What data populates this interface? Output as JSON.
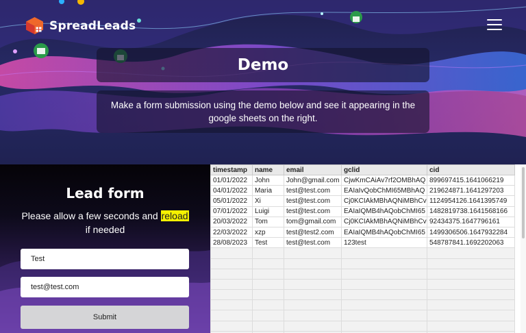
{
  "brand": {
    "name": "SpreadLeads"
  },
  "hero": {
    "title": "Demo",
    "description": "Make a form submission using the demo below and see it appearing in the google sheets on the right."
  },
  "form": {
    "title": "Lead form",
    "note_before": "Please allow a few seconds and ",
    "note_highlight": "reload",
    "note_after": " if needed",
    "name_value": "Test",
    "email_value": "test@test.com",
    "submit_label": "Submit"
  },
  "sheet": {
    "columns": [
      "timestamp",
      "name",
      "email",
      "gclid",
      "cid"
    ],
    "rows": [
      [
        "01/01/2022",
        "John",
        "John@gmail.com",
        "CjwKmCAiAv7rf2OMBhAQ",
        "899697415.1641066219"
      ],
      [
        "04/01/2022",
        "Maria",
        "test@test.com",
        "EAIaIvQobChMI65MBhAQ",
        "219624871.1641297203"
      ],
      [
        "05/01/2022",
        "Xi",
        "test@test.com",
        "Cj0KCIAkMBhAQNiMBhCv",
        "1124954126.1641395749"
      ],
      [
        "07/01/2022",
        "Luigi",
        "test@test.com",
        "EAIaIQMB4hAQobChMI65",
        "1482819738.1641568166"
      ],
      [
        "20/03/2022",
        "Tom",
        "tom@gmail.com",
        "Cj0KCIAkMBhAQNiMBhCv",
        "92434375.1647796161"
      ],
      [
        "22/03/2022",
        "xzp",
        "test@test2.com",
        "EAIaIQMB4hAQobChMI65",
        "1499306506.1647932284"
      ],
      [
        "28/08/2023",
        "Test",
        "test@test.com",
        "123test",
        "548787841.1692202063"
      ]
    ]
  }
}
